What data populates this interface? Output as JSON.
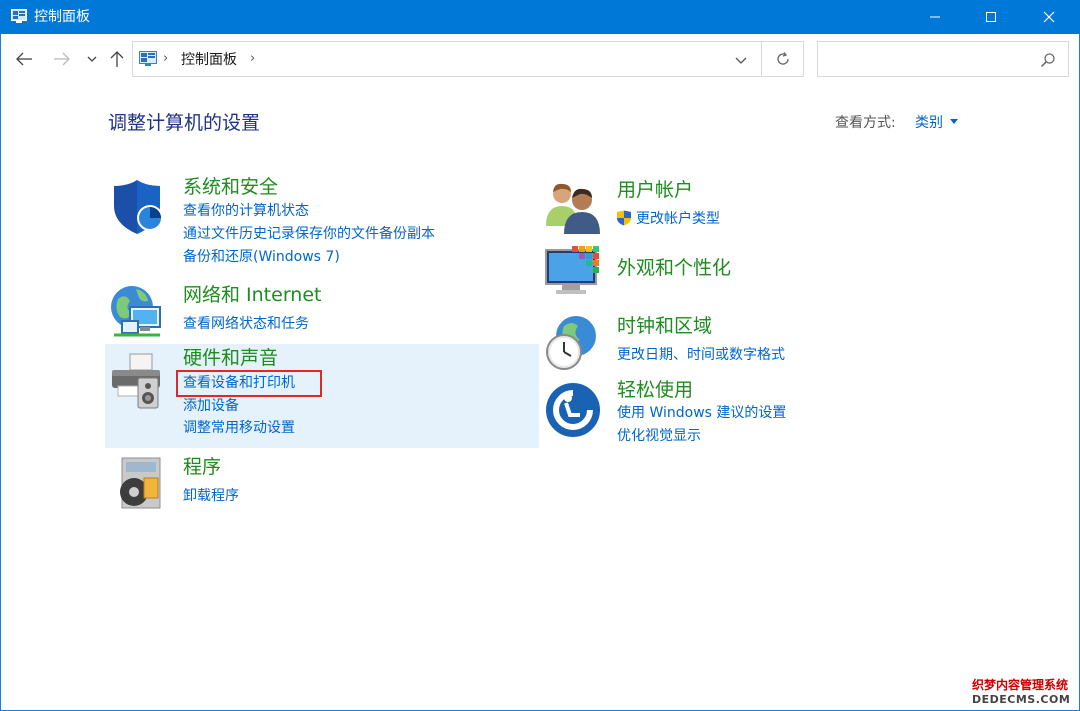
{
  "window": {
    "title": "控制面板",
    "accent_color": "#0078d7"
  },
  "navigation": {
    "back_icon": "arrow-left-icon",
    "forward_icon": "arrow-right-icon",
    "recent_icon": "chevron-down-icon",
    "up_icon": "arrow-up-icon",
    "breadcrumb": [
      "控制面板"
    ],
    "refresh_icon": "refresh-icon",
    "search_placeholder": ""
  },
  "header": {
    "title": "调整计算机的设置",
    "view_by_label": "查看方式:",
    "view_by_value": "类别"
  },
  "categories": {
    "system_security": {
      "title": "系统和安全",
      "icon": "shield-icon",
      "links": [
        "查看你的计算机状态",
        "通过文件历史记录保存你的文件备份副本",
        "备份和还原(Windows 7)"
      ]
    },
    "network": {
      "title": "网络和 Internet",
      "icon": "network-globe-icon",
      "links": [
        "查看网络状态和任务"
      ]
    },
    "hardware": {
      "title": "硬件和声音",
      "icon": "printer-speaker-icon",
      "links": [
        "查看设备和打印机",
        "添加设备",
        "调整常用移动设置"
      ],
      "highlighted_link": "查看设备和打印机"
    },
    "programs": {
      "title": "程序",
      "icon": "programs-disc-icon",
      "links": [
        "卸载程序"
      ]
    },
    "user_accounts": {
      "title": "用户帐户",
      "icon": "users-icon",
      "links": [
        "更改帐户类型"
      ]
    },
    "appearance": {
      "title": "外观和个性化",
      "icon": "monitor-palette-icon",
      "links": []
    },
    "clock_region": {
      "title": "时钟和区域",
      "icon": "clock-globe-icon",
      "links": [
        "更改日期、时间或数字格式"
      ]
    },
    "ease_of_access": {
      "title": "轻松使用",
      "icon": "ease-of-access-icon",
      "links": [
        "使用 Windows 建议的设置",
        "优化视觉显示"
      ]
    }
  },
  "watermark": {
    "line1": "织梦内容管理系统",
    "line2": "DEDECMS.COM"
  }
}
